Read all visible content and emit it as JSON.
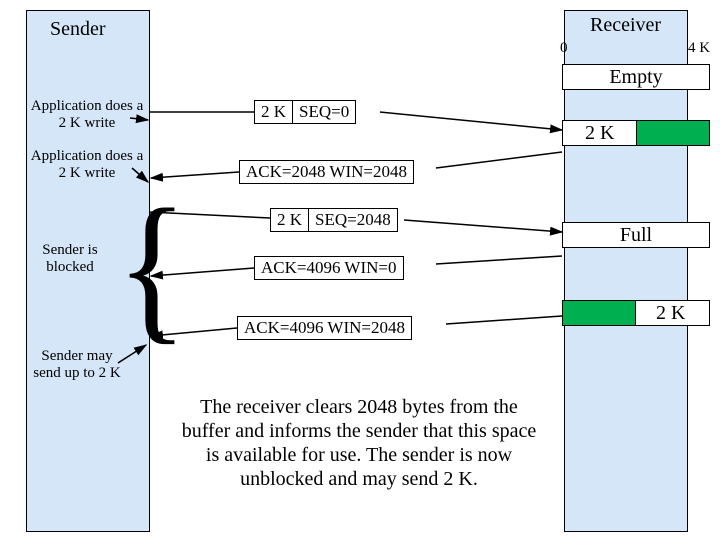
{
  "sender": {
    "title": "Sender"
  },
  "receiver": {
    "title": "Receiver",
    "tick0": "0",
    "tick4k": "4 K"
  },
  "buffers": {
    "empty": "Empty",
    "first_fill": "2 K",
    "full": "Full",
    "last_fill": "2 K"
  },
  "notes": {
    "write1": "Application does a 2 K write",
    "write2": "Application does a 2 K write",
    "blocked": "Sender is blocked",
    "may_send": "Sender may send up to 2 K"
  },
  "messages": {
    "m1_size": "2 K",
    "m1_seq": "SEQ=0",
    "m2": "ACK=2048 WIN=2048",
    "m3_size": "2 K",
    "m3_seq": "SEQ=2048",
    "m4": "ACK=4096 WIN=0",
    "m5": "ACK=4096 WIN=2048"
  },
  "caption": "The receiver clears 2048 bytes from the buffer and informs the sender that this space is available for use. The sender is now unblocked and may send 2 K."
}
